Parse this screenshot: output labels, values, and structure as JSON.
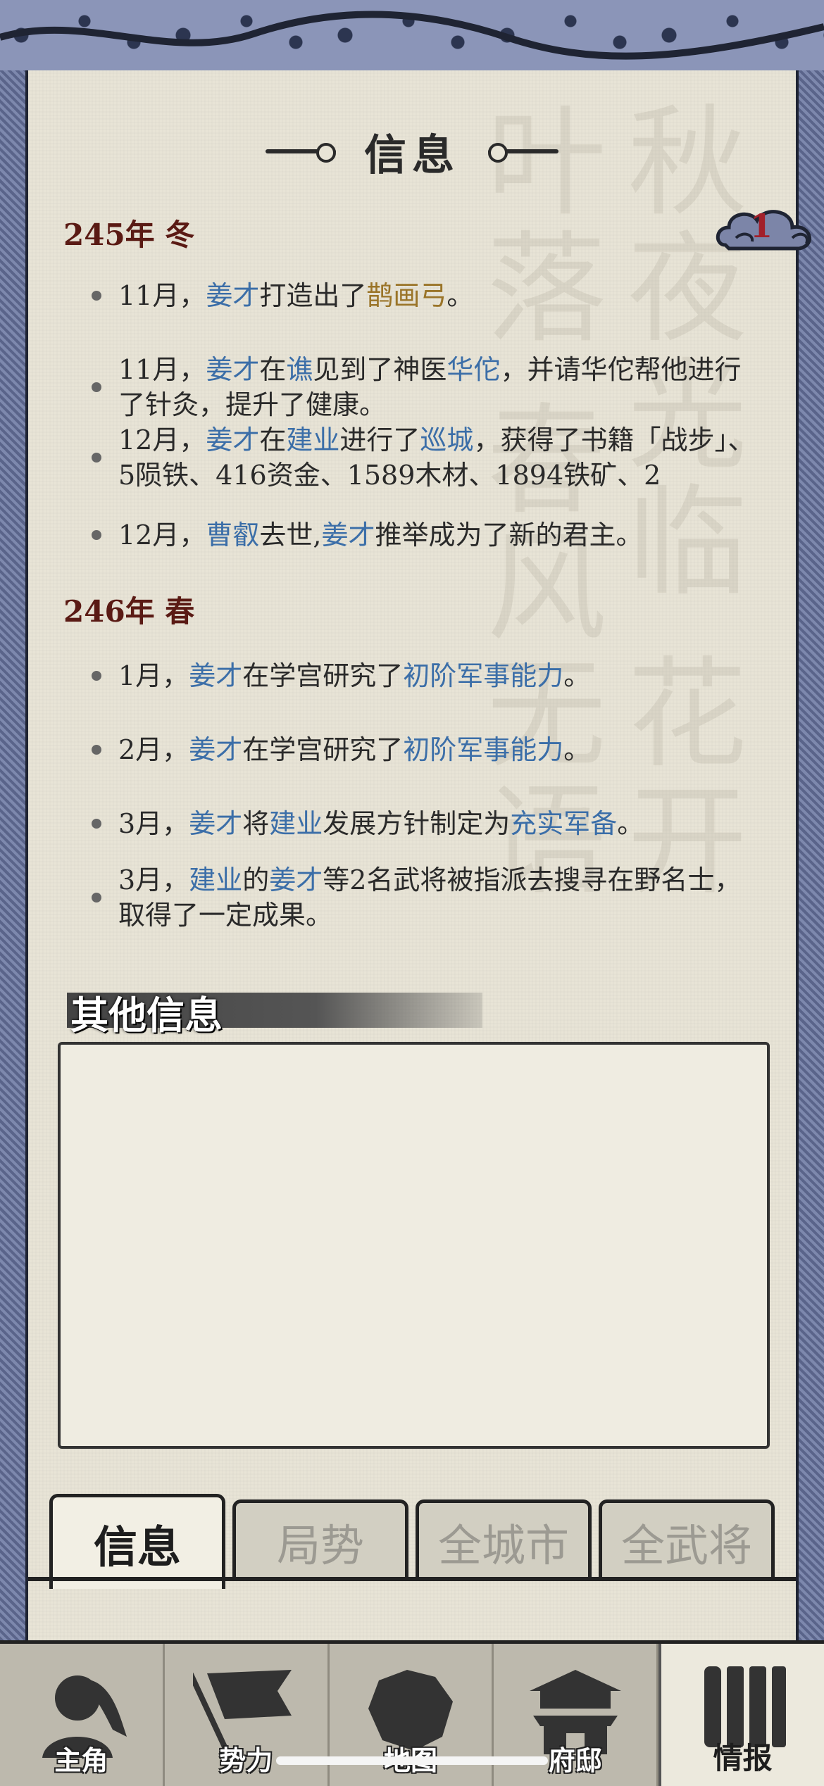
{
  "header": {
    "title": "信息",
    "badge_count": "1"
  },
  "sections": [
    {
      "season": "245年 冬",
      "entries": [
        {
          "parts": [
            {
              "t": "11月，",
              "c": ""
            },
            {
              "t": "姜才",
              "c": "blue"
            },
            {
              "t": "打造出了",
              "c": ""
            },
            {
              "t": "鹊画弓",
              "c": "gold"
            },
            {
              "t": "。",
              "c": ""
            }
          ]
        },
        {
          "parts": [
            {
              "t": "11月，",
              "c": ""
            },
            {
              "t": "姜才",
              "c": "blue"
            },
            {
              "t": "在",
              "c": ""
            },
            {
              "t": "谯",
              "c": "blue"
            },
            {
              "t": "见到了神医",
              "c": ""
            },
            {
              "t": "华佗",
              "c": "blue"
            },
            {
              "t": "，并请华佗帮他进行了针灸，提升了健康。",
              "c": ""
            }
          ]
        },
        {
          "parts": [
            {
              "t": "12月，",
              "c": ""
            },
            {
              "t": "姜才",
              "c": "blue"
            },
            {
              "t": "在",
              "c": ""
            },
            {
              "t": "建业",
              "c": "blue"
            },
            {
              "t": "进行了",
              "c": ""
            },
            {
              "t": "巡城",
              "c": "blue"
            },
            {
              "t": "，获得了书籍「战步」、5陨铁、416资金、1589木材、1894铁矿、2",
              "c": ""
            }
          ]
        },
        {
          "parts": [
            {
              "t": "12月，",
              "c": ""
            },
            {
              "t": "曹叡",
              "c": "blue"
            },
            {
              "t": "去世,",
              "c": ""
            },
            {
              "t": "姜才",
              "c": "blue"
            },
            {
              "t": "推举成为了新的君主。",
              "c": ""
            }
          ]
        }
      ]
    },
    {
      "season": "246年 春",
      "entries": [
        {
          "parts": [
            {
              "t": "1月，",
              "c": ""
            },
            {
              "t": "姜才",
              "c": "blue"
            },
            {
              "t": "在学宫研究了",
              "c": ""
            },
            {
              "t": "初阶军事能力",
              "c": "blue"
            },
            {
              "t": "。",
              "c": ""
            }
          ]
        },
        {
          "parts": [
            {
              "t": "2月，",
              "c": ""
            },
            {
              "t": "姜才",
              "c": "blue"
            },
            {
              "t": "在学宫研究了",
              "c": ""
            },
            {
              "t": "初阶军事能力",
              "c": "blue"
            },
            {
              "t": "。",
              "c": ""
            }
          ]
        },
        {
          "parts": [
            {
              "t": "3月，",
              "c": ""
            },
            {
              "t": "姜才",
              "c": "blue"
            },
            {
              "t": "将",
              "c": ""
            },
            {
              "t": "建业",
              "c": "blue"
            },
            {
              "t": "发展方针制定为",
              "c": ""
            },
            {
              "t": "充实军备",
              "c": "blue"
            },
            {
              "t": "。",
              "c": ""
            }
          ]
        },
        {
          "parts": [
            {
              "t": "3月，",
              "c": ""
            },
            {
              "t": "建业",
              "c": "blue"
            },
            {
              "t": "的",
              "c": ""
            },
            {
              "t": "姜才",
              "c": "blue"
            },
            {
              "t": "等2名武将被指派去搜寻在野名士，取得了一定成果。",
              "c": ""
            }
          ]
        }
      ]
    }
  ],
  "other_info": {
    "title": "其他信息"
  },
  "tabs": [
    {
      "label": "信息",
      "active": true
    },
    {
      "label": "局势",
      "active": false
    },
    {
      "label": "全城市",
      "active": false
    },
    {
      "label": "全武将",
      "active": false
    }
  ],
  "nav": [
    {
      "label": "主角",
      "icon": "character-icon"
    },
    {
      "label": "势力",
      "icon": "flag-icon"
    },
    {
      "label": "地图",
      "icon": "map-icon"
    },
    {
      "label": "府邸",
      "icon": "mansion-icon"
    },
    {
      "label": "情报",
      "icon": "scroll-icon",
      "active": true
    }
  ]
}
